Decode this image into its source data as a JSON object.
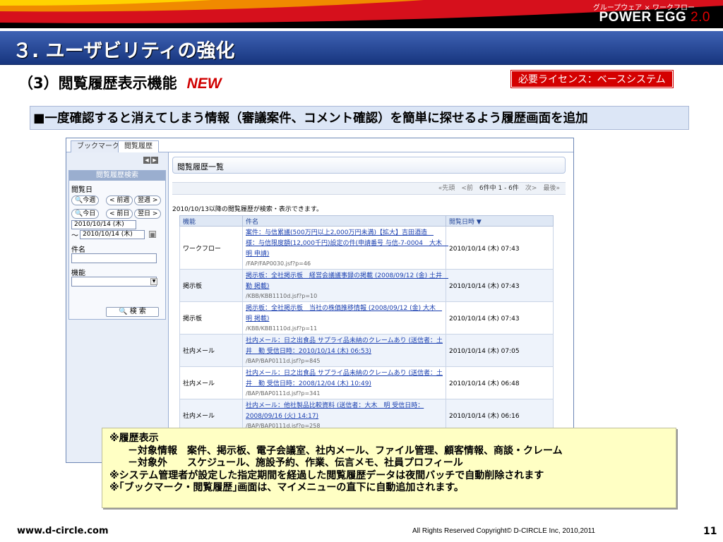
{
  "brand": {
    "sub": "グループウェア × ワークフロー",
    "name": "POWER EGG",
    "version": "2.0"
  },
  "slide": {
    "title": "３. ユーザビリティの強化",
    "subtitle": "（3）閲覧履歴表示機能",
    "new_badge": "NEW",
    "license": "必要ライセンス：ベースシステム"
  },
  "lead": "■一度確認すると消えてしまう情報（審議案件、コメント確認）を簡単に探せるよう履歴画面を追加",
  "app": {
    "tabs": [
      "ブックマーク",
      "閲覧履歴"
    ],
    "search": {
      "title": "閲覧履歴検索",
      "date_label": "閲覧日",
      "btn_this_week": "今週",
      "btn_prev_week": "< 前週",
      "btn_next_week": "翌週 >",
      "btn_today": "今日",
      "btn_prev_day": "< 前日",
      "btn_next_day": "翌日 >",
      "date_from": "2010/10/14 (木)",
      "range_sep": "〜",
      "date_to": "2010/10/14 (木)",
      "subject_label": "件名",
      "function_label": "機能",
      "search_button": "検 索"
    },
    "list": {
      "title": "閲覧履歴一覧",
      "pager_first": "«先頭",
      "pager_prev": "<前",
      "pager_info": "6件中 1 - 6件",
      "pager_next": "次>",
      "pager_last": "最後»",
      "notice": "2010/10/13以降の閲覧履歴が検索・表示できます。",
      "headers": [
        "機能",
        "件名",
        "閲覧日時 ▼"
      ],
      "rows": [
        {
          "func": "ワークフロー",
          "title": "案件：与信累議(500万円以上2,000万円未満)【拡大】吉田酒造　様：与信限度額(12,000千円)設定の件(申請番号 与信-7-0004　大木　明 申請)",
          "path": "/FAP/FAP0030.jsf?p=46",
          "date": "2010/10/14 (木) 07:43"
        },
        {
          "func": "掲示板",
          "title": "掲示板：全社掲示板　経営会議議事録の掲載 (2008/09/12 (金) 土井　勤 掲載)",
          "path": "/KBB/KBB1110d.jsf?p=10",
          "date": "2010/10/14 (木) 07:43"
        },
        {
          "func": "掲示板",
          "title": "掲示板：全社掲示板　当社の株価推移情報 (2008/09/12 (金) 大木　明 掲載)",
          "path": "/KBB/KBB1110d.jsf?p=11",
          "date": "2010/10/14 (木) 07:43"
        },
        {
          "func": "社内メール",
          "title": "社内メール：日之出食品 サプライ品未納のクレームあり (送信者：土井　勤 受信日時：2010/10/14 (木) 06:53)",
          "path": "/BAP/BAP0111d.jsf?p=845",
          "date": "2010/10/14 (木) 07:05"
        },
        {
          "func": "社内メール",
          "title": "社内メール：日之出食品 サプライ品未納のクレームあり (送信者：土井　勤 受信日時：2008/12/04 (木) 10:49)",
          "path": "/BAP/BAP0111d.jsf?p=341",
          "date": "2010/10/14 (木) 06:48"
        },
        {
          "func": "社内メール",
          "title": "社内メール：他社製品比較資料 (送信者：大木　明 受信日時：2008/09/16 (火) 14:17)",
          "path": "/BAP/BAP0111d.jsf?p=258",
          "date": "2010/10/14 (木) 06:16"
        }
      ]
    }
  },
  "notes": {
    "heading": "※履歴表示",
    "target": "－対象情報　案件、掲示板、電子会議室、社内メール、ファイル管理、顧客情報、商談・クレーム",
    "excluded": "－対象外　　スケジュール、施設予約、作業、伝言メモ、社員プロフィール",
    "admin": "※システム管理者が設定した指定期間を経過した閲覧履歴データは夜間バッチで自動削除されます",
    "menu": "※｢ブックマーク・閲覧履歴｣画面は、マイメニューの直下に自動追加されます。"
  },
  "footer": {
    "site": "www.d-circle.com",
    "copyright": "All Rights Reserved Copyright© D-CIRCLE  Inc, 2010,2011",
    "page": "11"
  }
}
